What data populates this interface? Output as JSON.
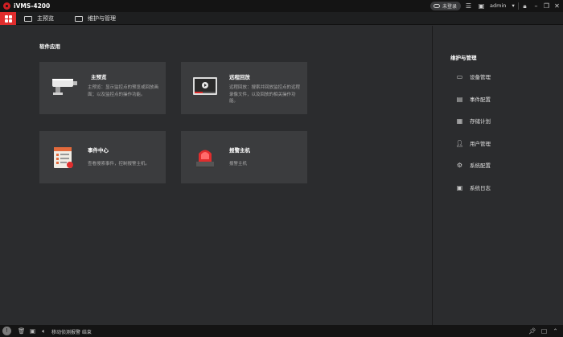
{
  "app": {
    "title": "iVMS-4200",
    "login_status": "未登录",
    "user": "admin"
  },
  "tabs": [
    {
      "label": "主预览"
    },
    {
      "label": "维护与管理"
    }
  ],
  "main": {
    "section_title": "软件应用",
    "cards": [
      {
        "title": "主预览",
        "desc": "主预览：显示监控点的预览或回放画面；以及监控点的操作功能。"
      },
      {
        "title": "远程回放",
        "desc": "远程回放：搜索并回放监控点的远程录像文件，以及回放的相关操作功能。"
      },
      {
        "title": "事件中心",
        "desc": "查看搜索事件，控制报警主机。"
      },
      {
        "title": "报警主机",
        "desc": "报警主机"
      }
    ]
  },
  "right_panel": {
    "title": "维护与管理",
    "items": [
      {
        "label": "设备管理",
        "icon": "device-icon"
      },
      {
        "label": "事件配置",
        "icon": "event-icon"
      },
      {
        "label": "存储计划",
        "icon": "storage-icon"
      },
      {
        "label": "用户管理",
        "icon": "user-icon"
      },
      {
        "label": "系统配置",
        "icon": "gear-icon"
      },
      {
        "label": "系统日志",
        "icon": "log-icon"
      }
    ]
  },
  "statusbar": {
    "message": "移动侦测报警 结束"
  },
  "colors": {
    "accent": "#e02d2d",
    "background": "#2b2c2e",
    "card": "#3b3c3e",
    "titlebar": "#141414"
  }
}
